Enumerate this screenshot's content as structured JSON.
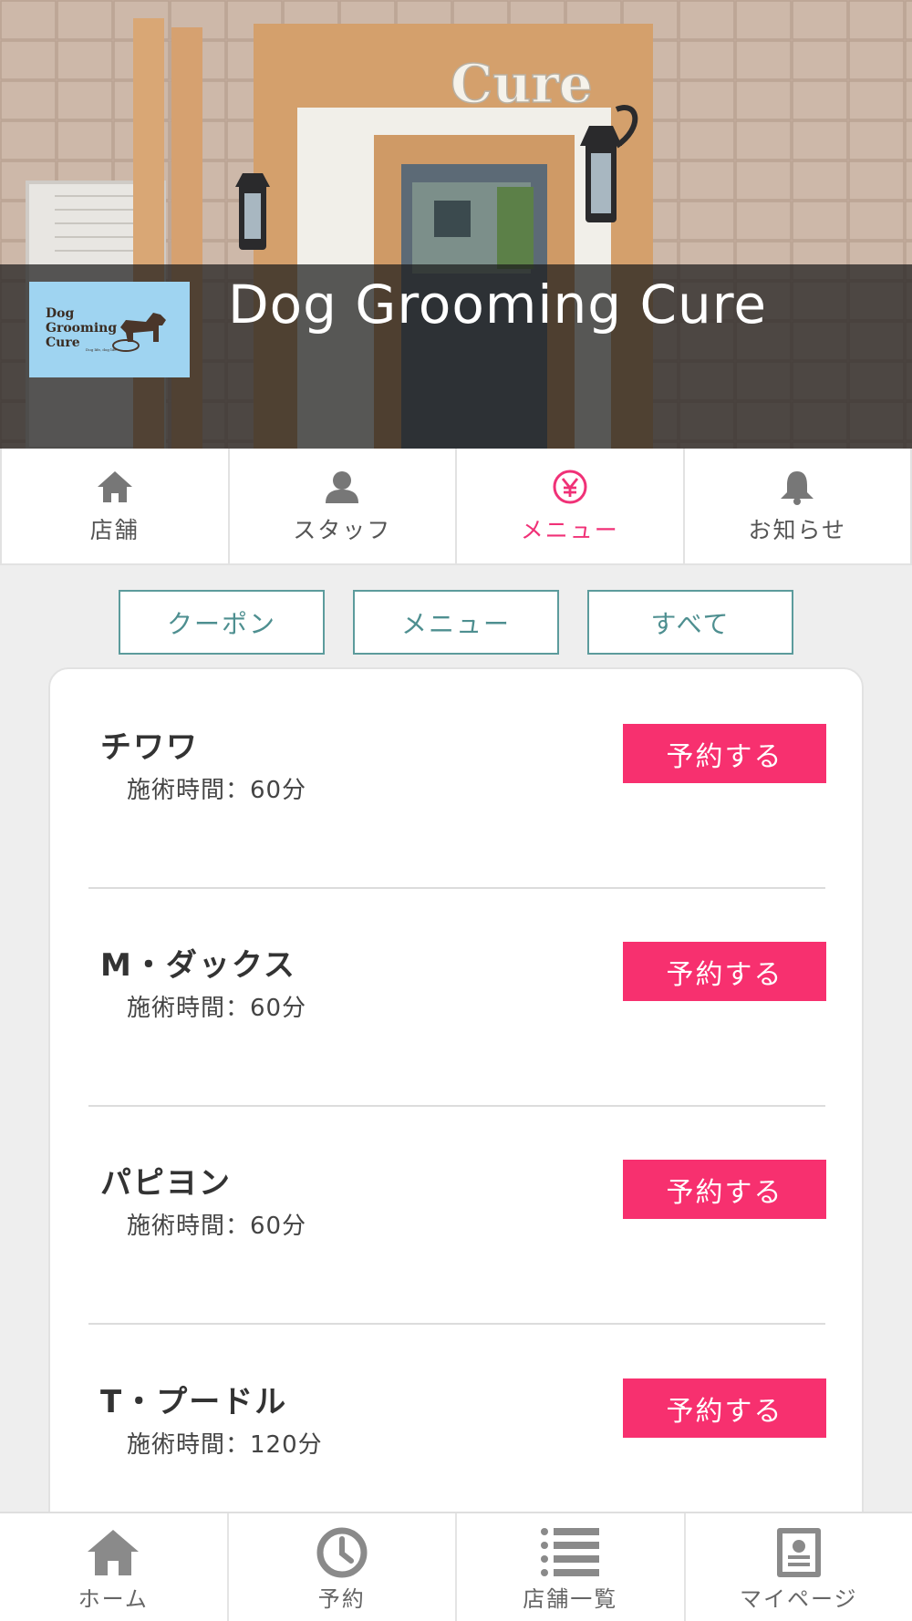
{
  "shop": {
    "name": "Dog Grooming Cure",
    "sign_text": "Cure",
    "logo_lines": [
      "Dog",
      "Grooming",
      "Cure"
    ],
    "logo_tagline": "Dog life, dog life"
  },
  "tabs": [
    {
      "label": "店舗",
      "icon": "home-icon",
      "active": false
    },
    {
      "label": "スタッフ",
      "icon": "person-icon",
      "active": false
    },
    {
      "label": "メニュー",
      "icon": "yen-icon",
      "active": true
    },
    {
      "label": "お知らせ",
      "icon": "bell-icon",
      "active": false
    }
  ],
  "filters": [
    "クーポン",
    "メニュー",
    "すべて"
  ],
  "menu_items": [
    {
      "name": "チワワ",
      "time": "施術時間：60分",
      "button": "予約する"
    },
    {
      "name": "M・ダックス",
      "time": "施術時間：60分",
      "button": "予約する"
    },
    {
      "name": "パピヨン",
      "time": "施術時間：60分",
      "button": "予約する"
    },
    {
      "name": "T・プードル",
      "time": "施術時間：120分",
      "button": "予約する"
    }
  ],
  "bottom_nav": [
    {
      "label": "ホーム",
      "icon": "home-icon"
    },
    {
      "label": "予約",
      "icon": "clock-icon"
    },
    {
      "label": "店舗一覧",
      "icon": "list-icon"
    },
    {
      "label": "マイページ",
      "icon": "profile-card-icon"
    }
  ],
  "colors": {
    "accent_pink": "#f7306f",
    "teal": "#5c9b9c",
    "logo_blue": "#9fd4f1"
  }
}
